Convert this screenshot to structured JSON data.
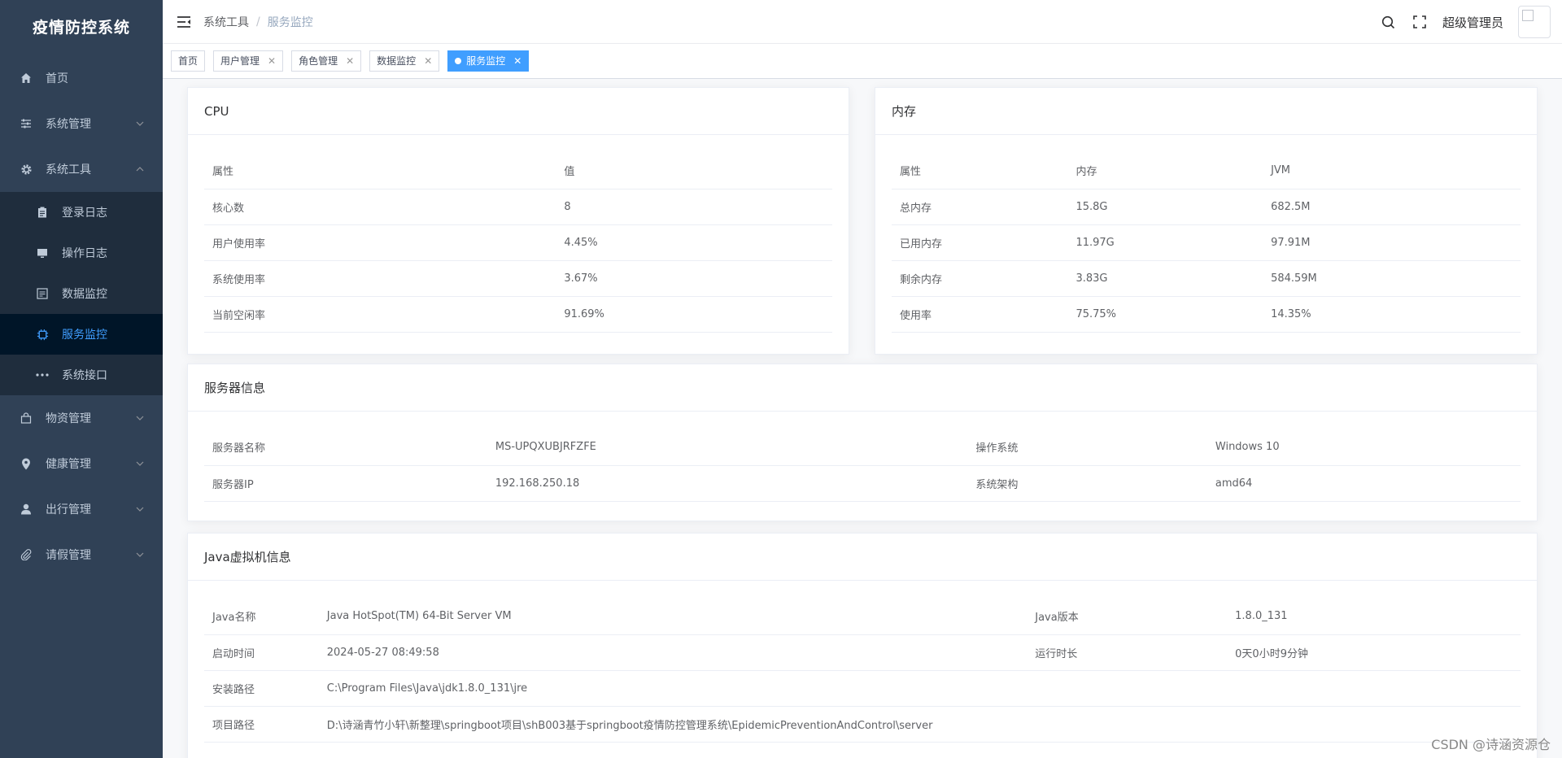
{
  "app": {
    "title": "疫情防控系统"
  },
  "sidebar": {
    "items": [
      {
        "label": "首页",
        "icon": "home-icon"
      },
      {
        "label": "系统管理",
        "icon": "sliders-icon"
      },
      {
        "label": "系统工具",
        "icon": "gear-icon"
      },
      {
        "label": "物资管理",
        "icon": "bag-icon"
      },
      {
        "label": "健康管理",
        "icon": "location-icon"
      },
      {
        "label": "出行管理",
        "icon": "user-icon"
      },
      {
        "label": "请假管理",
        "icon": "paperclip-icon"
      }
    ],
    "submenu": [
      {
        "label": "登录日志",
        "icon": "clipboard-icon"
      },
      {
        "label": "操作日志",
        "icon": "monitor-icon"
      },
      {
        "label": "数据监控",
        "icon": "data-icon"
      },
      {
        "label": "服务监控",
        "icon": "cpu-icon"
      },
      {
        "label": "系统接口",
        "icon": "more-icon"
      }
    ]
  },
  "header": {
    "breadcrumb": [
      "系统工具",
      "服务监控"
    ],
    "username": "超级管理员"
  },
  "tags": [
    "首页",
    "用户管理",
    "角色管理",
    "数据监控",
    "服务监控"
  ],
  "cpu": {
    "title": "CPU",
    "headers": [
      "属性",
      "值"
    ],
    "rows": [
      [
        "核心数",
        "8"
      ],
      [
        "用户使用率",
        "4.45%"
      ],
      [
        "系统使用率",
        "3.67%"
      ],
      [
        "当前空闲率",
        "91.69%"
      ]
    ]
  },
  "memory": {
    "title": "内存",
    "headers": [
      "属性",
      "内存",
      "JVM"
    ],
    "rows": [
      [
        "总内存",
        "15.8G",
        "682.5M"
      ],
      [
        "已用内存",
        "11.97G",
        "97.91M"
      ],
      [
        "剩余内存",
        "3.83G",
        "584.59M"
      ],
      [
        "使用率",
        "75.75%",
        "14.35%"
      ]
    ]
  },
  "server": {
    "title": "服务器信息",
    "rows": [
      [
        "服务器名称",
        "MS-UPQXUBJRFZFE",
        "操作系统",
        "Windows 10"
      ],
      [
        "服务器IP",
        "192.168.250.18",
        "系统架构",
        "amd64"
      ]
    ]
  },
  "jvm": {
    "title": "Java虚拟机信息",
    "rows": [
      [
        "Java名称",
        "Java HotSpot(TM) 64-Bit Server VM",
        "Java版本",
        "1.8.0_131"
      ],
      [
        "启动时间",
        "2024-05-27 08:49:58",
        "运行时长",
        "0天0小时9分钟"
      ]
    ],
    "paths": [
      [
        "安装路径",
        "C:\\Program Files\\Java\\jdk1.8.0_131\\jre"
      ],
      [
        "项目路径",
        "D:\\诗涵青竹小轩\\新整理\\springboot项目\\shB003基于springboot疫情防控管理系统\\EpidemicPreventionAndControl\\server"
      ]
    ]
  },
  "watermark": "CSDN @诗涵资源仓"
}
